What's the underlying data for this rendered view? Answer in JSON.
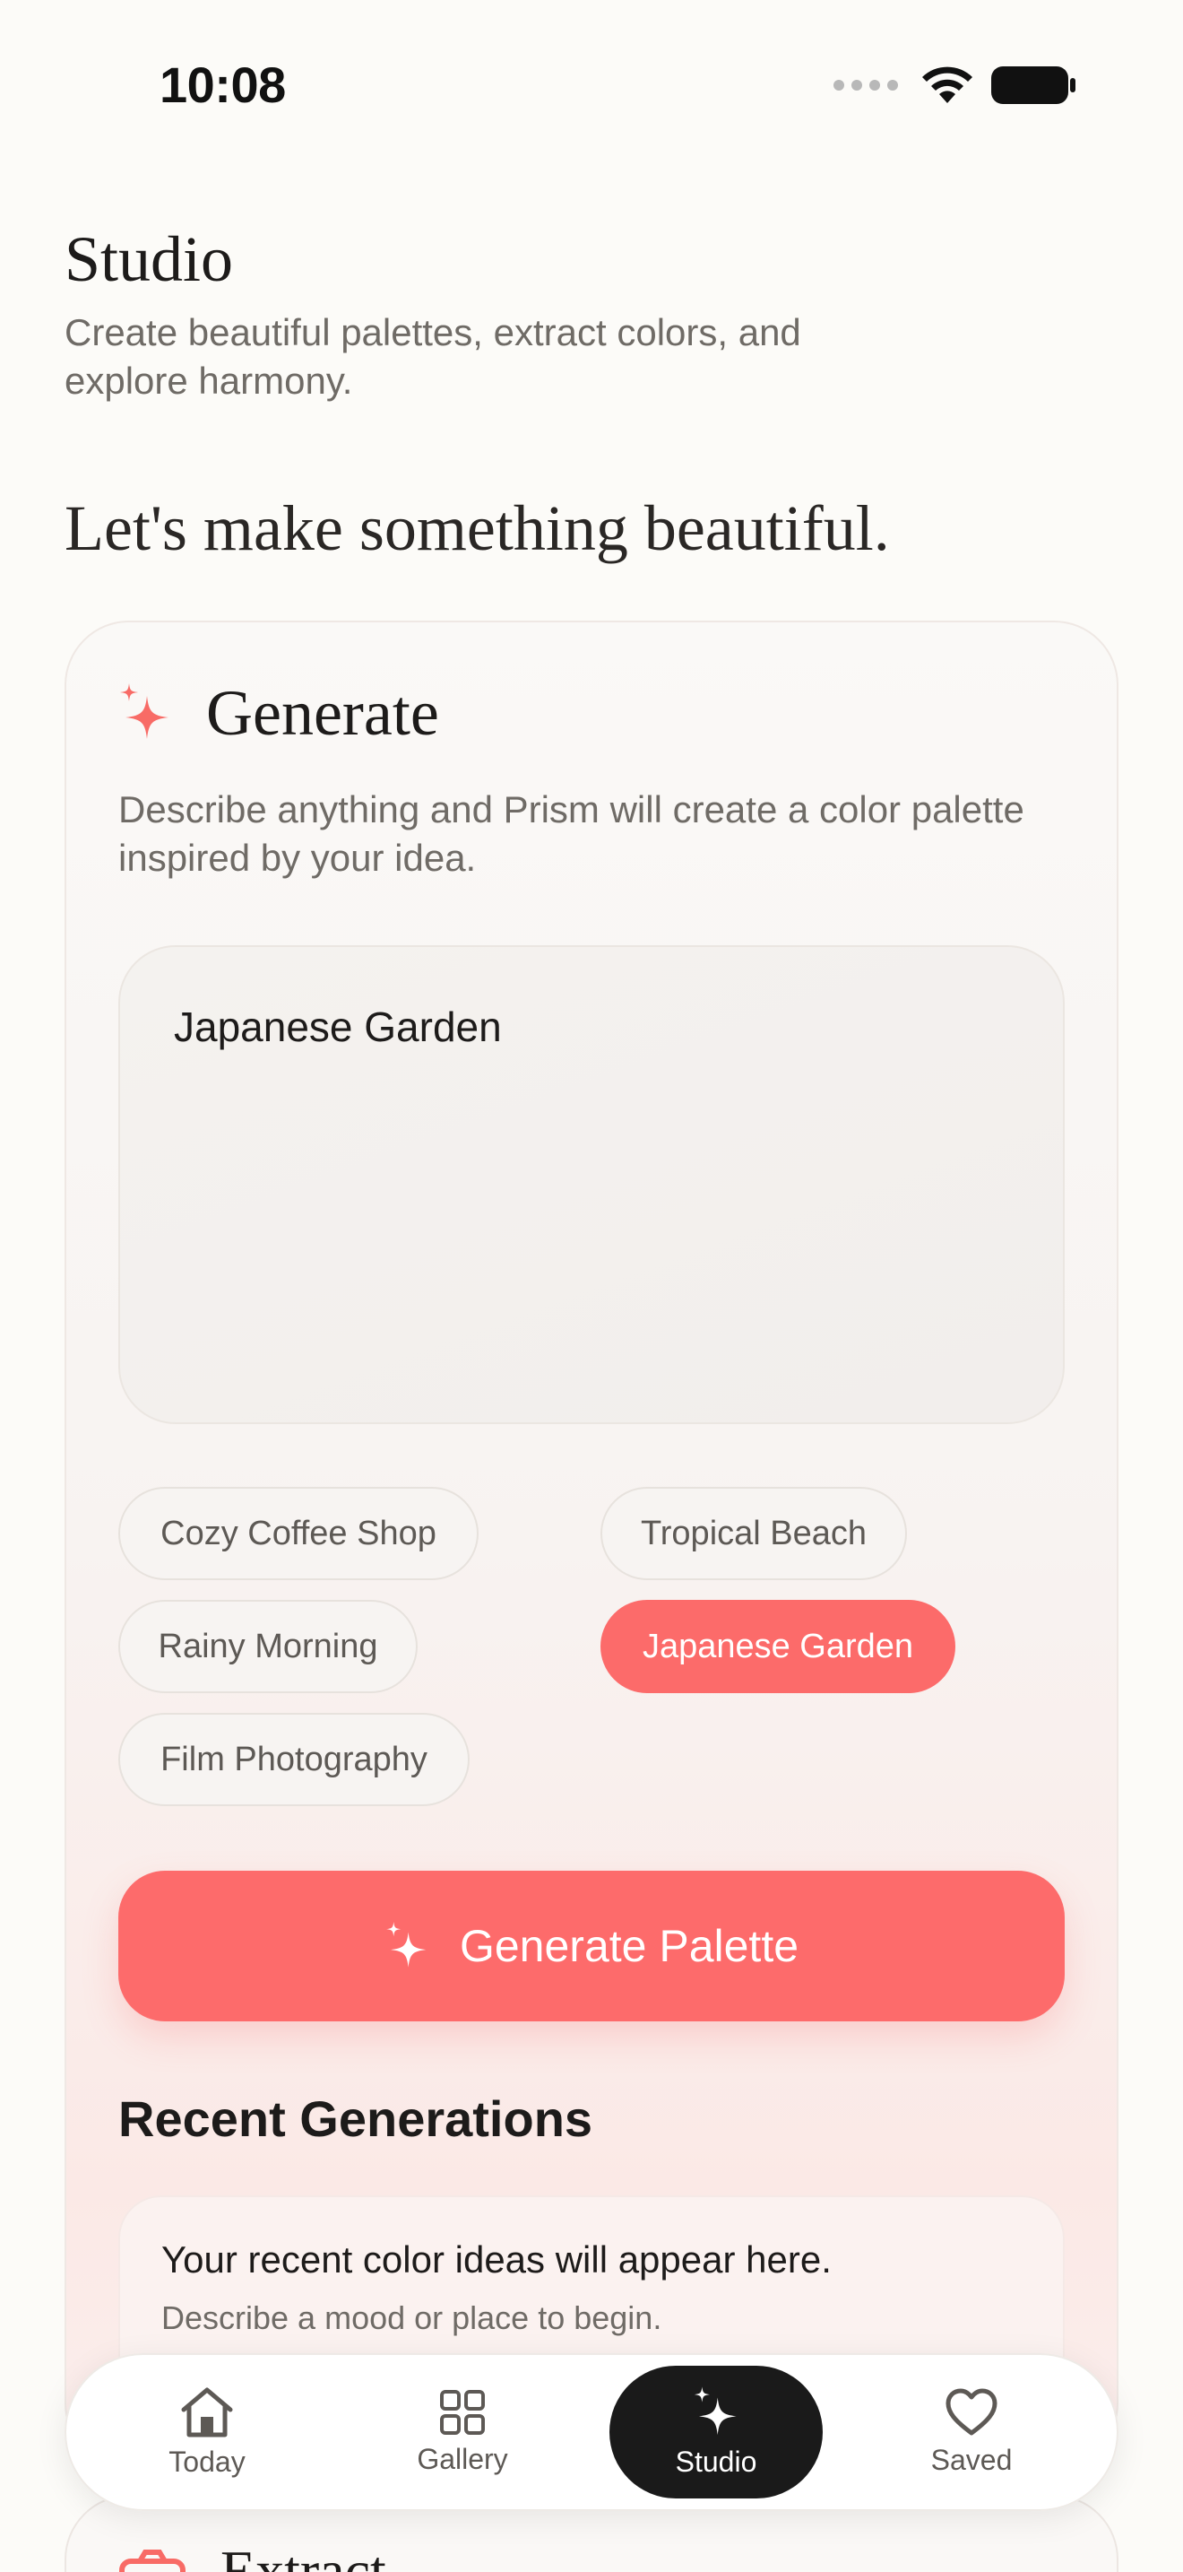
{
  "status_bar": {
    "time": "10:08"
  },
  "header": {
    "title": "Studio",
    "subtitle": "Create beautiful palettes, extract colors, and explore harmony."
  },
  "hero": {
    "heading": "Let's make something beautiful."
  },
  "generate": {
    "title": "Generate",
    "description": "Describe anything and Prism will create a color palette inspired by your idea.",
    "prompt_value": "Japanese Garden",
    "suggestions": [
      {
        "label": "Cozy Coffee Shop",
        "selected": false
      },
      {
        "label": "Tropical Beach",
        "selected": false
      },
      {
        "label": "Rainy Morning",
        "selected": false
      },
      {
        "label": "Japanese Garden",
        "selected": true
      },
      {
        "label": "Film Photography",
        "selected": false
      }
    ],
    "button_label": "Generate Palette"
  },
  "recent": {
    "title": "Recent Generations",
    "empty_title": "Your recent color ideas will appear here.",
    "empty_subtitle": "Describe a mood or place to begin."
  },
  "extract": {
    "title": "Extract"
  },
  "tabbar": {
    "items": [
      {
        "label": "Today",
        "icon": "house-icon",
        "active": false
      },
      {
        "label": "Gallery",
        "icon": "grid-icon",
        "active": false
      },
      {
        "label": "Studio",
        "icon": "sparkles-icon",
        "active": true
      },
      {
        "label": "Saved",
        "icon": "heart-icon",
        "active": false
      }
    ]
  },
  "colors": {
    "accent": "#fc6b6a",
    "text": "#1d1b1a",
    "muted": "#6f6b66",
    "tab_active": "#1a1a1a"
  }
}
